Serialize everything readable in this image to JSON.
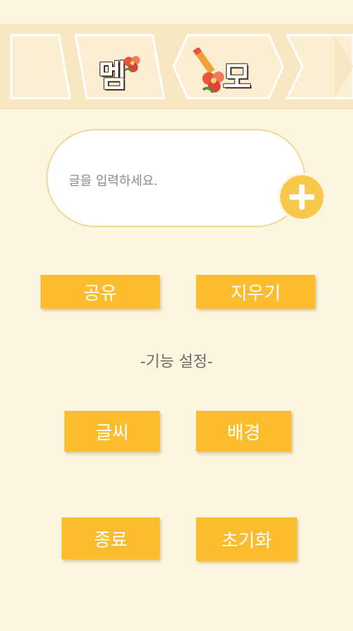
{
  "header": {
    "title_char_1": "멤",
    "title_char_2": "모"
  },
  "memo": {
    "placeholder": "글을 입력하세요."
  },
  "actions": {
    "share_label": "공유",
    "erase_label": "지우기"
  },
  "settings": {
    "section_label": "-기능 설정-",
    "font_label": "글씨",
    "background_label": "배경",
    "exit_label": "종료",
    "reset_label": "초기화"
  },
  "colors": {
    "background": "#fdf6de",
    "banner": "#f7e7c3",
    "button": "#fbbd2e",
    "add_button": "#f8c84a"
  },
  "icons": {
    "add": "plus-icon",
    "flower": "flower-icon",
    "pencil": "pencil-icon"
  }
}
